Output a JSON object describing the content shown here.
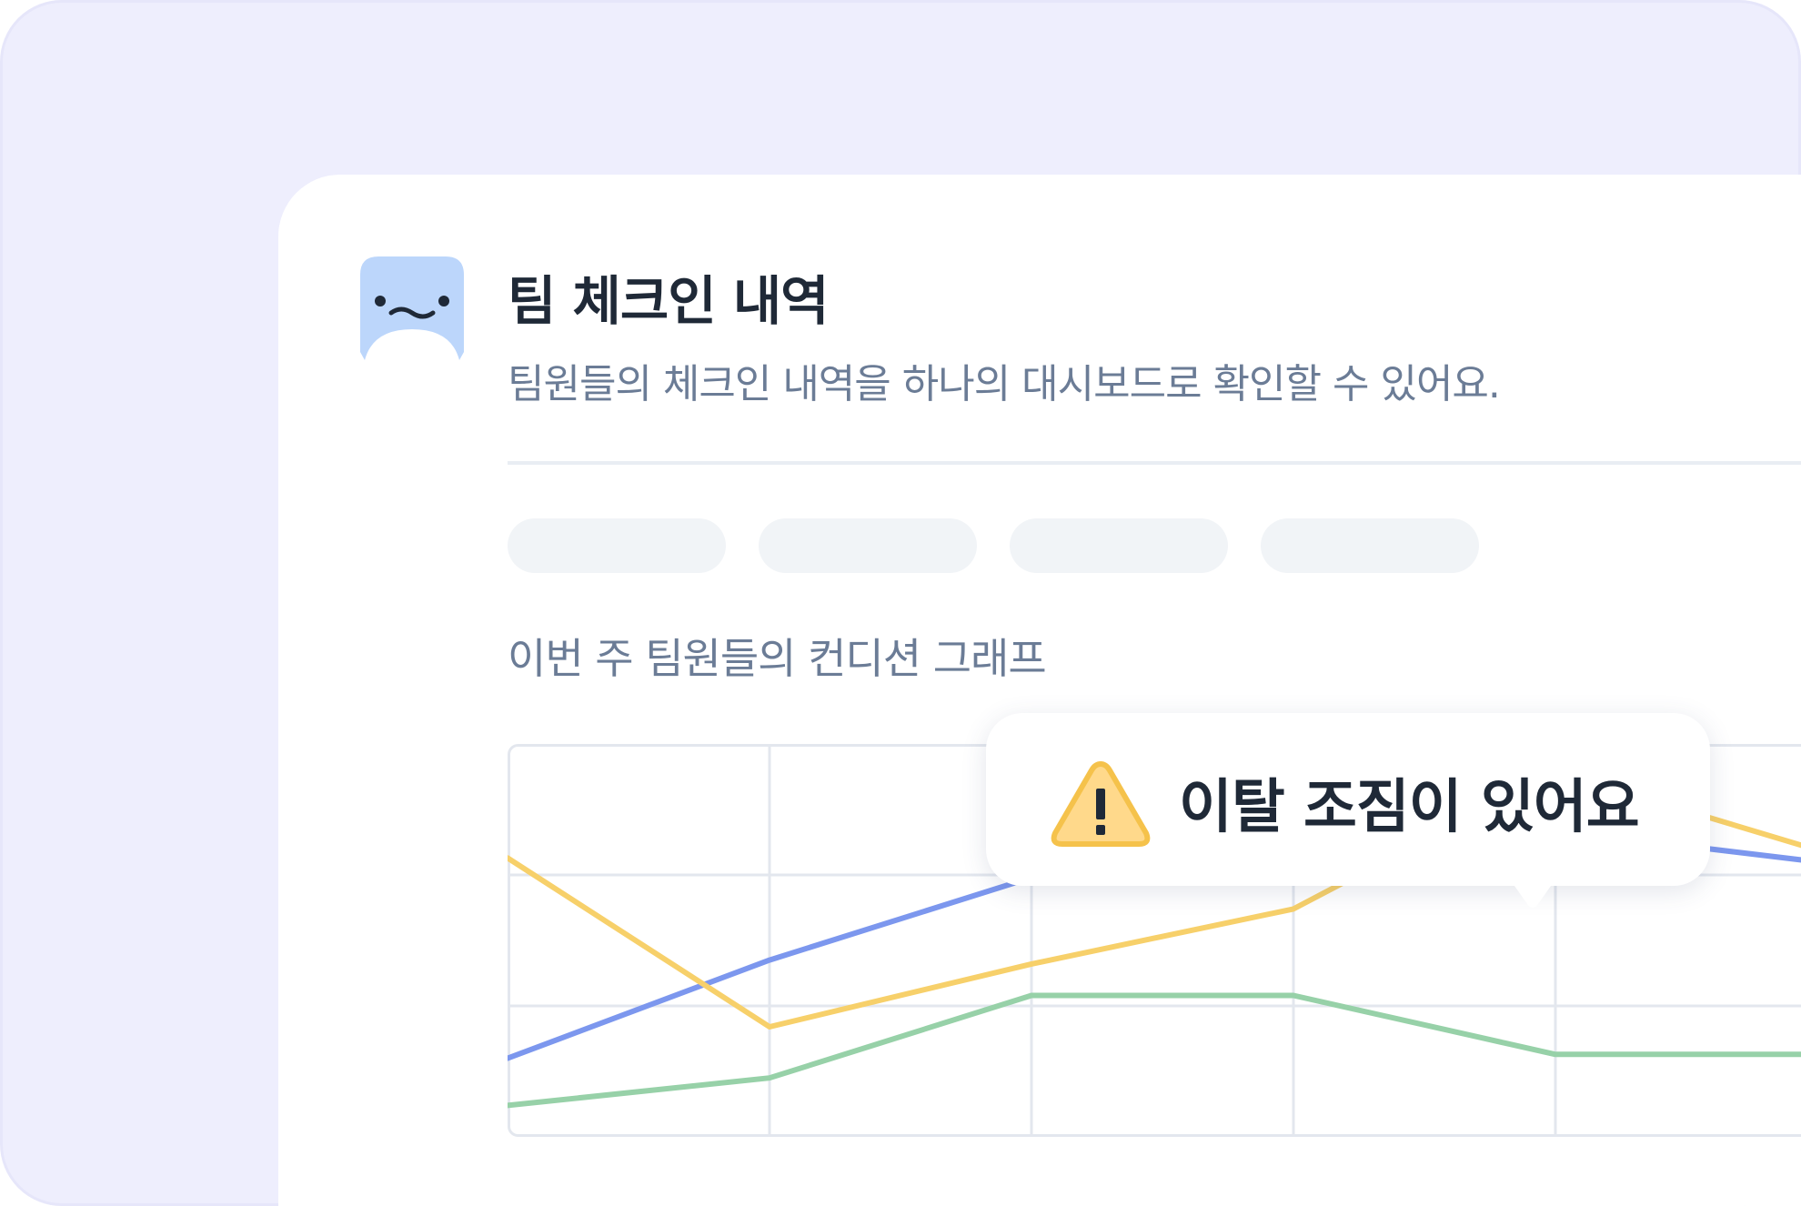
{
  "header": {
    "title": "팀 체크인 내역",
    "subtitle": "팀원들의 체크인 내역을 하나의 대시보드로 확인할 수 있어요."
  },
  "graph": {
    "label": "이번 주 팀원들의 컨디션 그래프"
  },
  "alert": {
    "message": "이탈 조짐이 있어요",
    "icon": "warning-icon"
  },
  "colors": {
    "background": "#eeeefd",
    "avatar": "#bcd6fb",
    "series_blue": "#7c97ee",
    "series_yellow": "#f7d06a",
    "series_green": "#97d1a8",
    "warning_fill": "#ffd98b",
    "warning_stroke": "#f5c24b"
  },
  "chart_data": {
    "type": "line",
    "grid": true,
    "series": [
      {
        "values": [
          20,
          45,
          66,
          82,
          78,
          70
        ]
      },
      {
        "values": [
          71,
          28,
          44,
          58,
          93,
          73
        ]
      },
      {
        "values": [
          8,
          15,
          36,
          36,
          21,
          21
        ]
      }
    ]
  }
}
